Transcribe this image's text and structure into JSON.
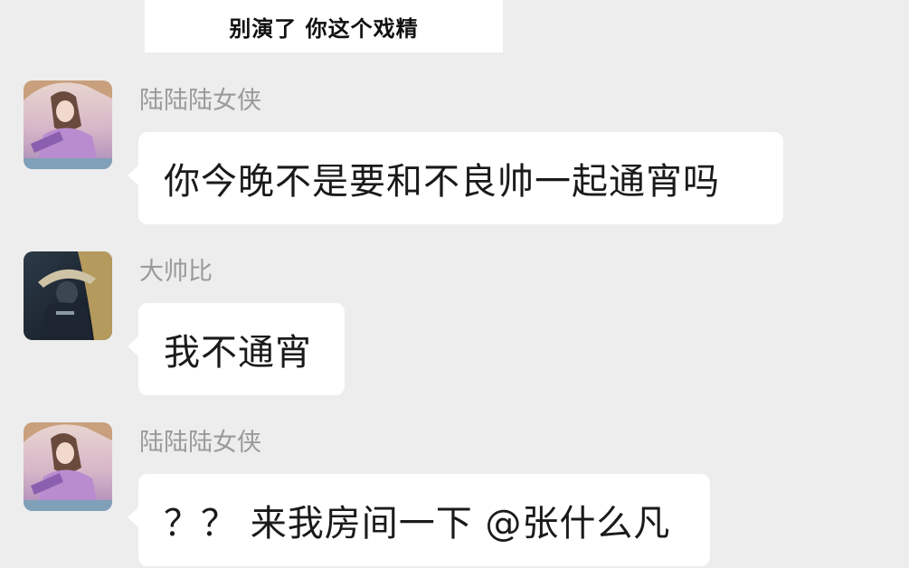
{
  "caption": "别演了 你这个戏精",
  "messages": [
    {
      "sender": "陆陆陆女侠",
      "avatar_icon": "heroine-avatar-icon",
      "text": "你今晚不是要和不良帅一起通宵吗"
    },
    {
      "sender": "大帅比",
      "avatar_icon": "masked-hero-avatar-icon",
      "text": "我不通宵"
    },
    {
      "sender": "陆陆陆女侠",
      "avatar_icon": "heroine-avatar-icon",
      "text": "？？ 来我房间一下 @张什么凡"
    }
  ],
  "colors": {
    "background": "#ededed",
    "bubble": "#ffffff",
    "sender_name": "#9a9a9a",
    "message_text": "#1a1a1a"
  }
}
